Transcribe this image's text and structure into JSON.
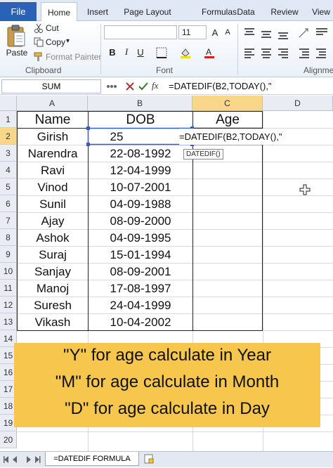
{
  "ribbon": {
    "tabs": [
      {
        "label": "File"
      },
      {
        "label": "Home"
      },
      {
        "label": "Insert"
      },
      {
        "label": "Page Layout"
      },
      {
        "label": "Formulas"
      },
      {
        "label": "Data"
      },
      {
        "label": "Review"
      },
      {
        "label": "View"
      }
    ],
    "clipboard": {
      "paste": "Paste",
      "cut": "Cut",
      "copy": "Copy",
      "copy_arrow": "▾",
      "format_painter": "Format Painter",
      "group_label": "Clipboard"
    },
    "font": {
      "size": "11",
      "grow": "A",
      "shrink": "A",
      "bold": "B",
      "italic": "I",
      "underline": "U",
      "group_label": "Font"
    },
    "alignment": {
      "group_label": "Alignme"
    }
  },
  "formula_bar": {
    "name_box": "SUM",
    "fx": "fx",
    "formula": "=DATEDIF(B2,TODAY(),\""
  },
  "grid": {
    "columns": [
      "A",
      "B",
      "C",
      "D"
    ],
    "rows": [
      "1",
      "2",
      "3",
      "4",
      "5",
      "6",
      "7",
      "8",
      "9",
      "10",
      "11",
      "12",
      "13",
      "14",
      "15",
      "16",
      "17",
      "18",
      "19",
      "20"
    ],
    "headers": {
      "name": "Name",
      "dob": "DOB",
      "age": "Age"
    },
    "records": [
      {
        "name": "Girish",
        "dob": "25"
      },
      {
        "name": "Narendra",
        "dob": "22-08-1992"
      },
      {
        "name": "Ravi",
        "dob": "12-04-1999"
      },
      {
        "name": "Vinod",
        "dob": "10-07-2001"
      },
      {
        "name": "Sunil",
        "dob": "04-09-1988"
      },
      {
        "name": "Ajay",
        "dob": "08-09-2000"
      },
      {
        "name": "Ashok",
        "dob": "04-09-1995"
      },
      {
        "name": "Suraj",
        "dob": "15-01-1994"
      },
      {
        "name": "Sanjay",
        "dob": "08-09-2001"
      },
      {
        "name": "Manoj",
        "dob": "17-08-1997"
      },
      {
        "name": "Suresh",
        "dob": "24-04-1999"
      },
      {
        "name": "Vikash",
        "dob": "10-04-2002"
      }
    ],
    "active_cell_text": "=DATEDIF(B2,TODAY(),\"",
    "tooltip": "DATEDIF()"
  },
  "overlay": {
    "lines": [
      "\"Y\" for age calculate in Year",
      "\"M\" for age calculate in Month",
      "\"D\" for age calculate in Day"
    ]
  },
  "sheet": {
    "tab_label": "=DATEDIF FORMULA"
  },
  "colors": {
    "file_tab": "#2a62b8",
    "selected_header": "#f8d68a",
    "banner": "#f6c64d",
    "range_border": "#2a5fd0"
  }
}
